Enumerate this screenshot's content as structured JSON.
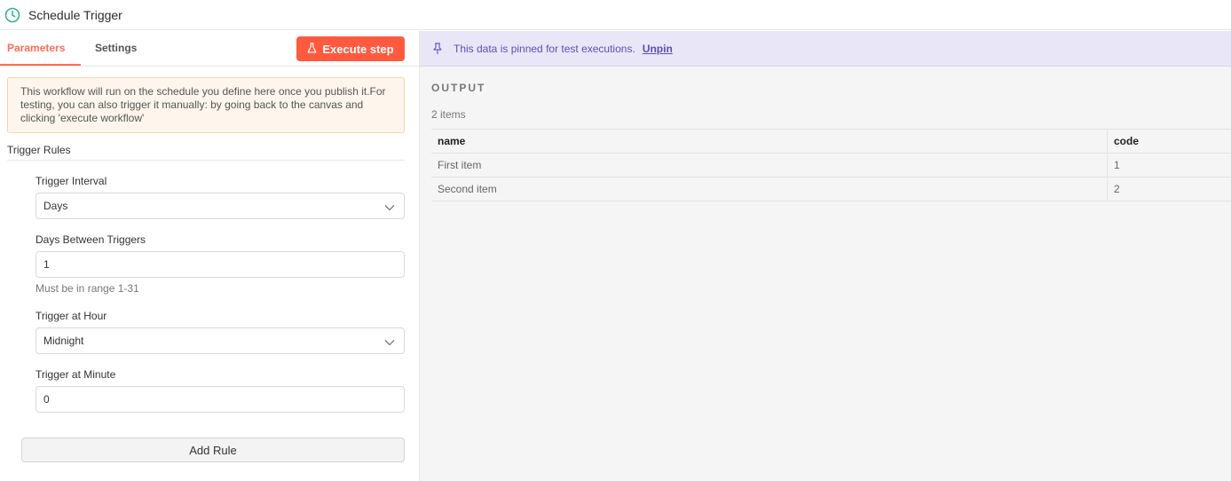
{
  "header": {
    "title": "Schedule Trigger",
    "icon": "clock-icon"
  },
  "tabs": [
    {
      "label": "Parameters",
      "active": true
    },
    {
      "label": "Settings",
      "active": false
    }
  ],
  "execute_button": {
    "label": "Execute step",
    "icon": "flask-icon"
  },
  "notice": {
    "text": "This workflow will run on the schedule you define here once you publish it.For testing, you can also trigger it manually: by going back to the canvas and clicking 'execute workflow'"
  },
  "trigger_rules": {
    "title": "Trigger Rules",
    "fields": {
      "interval": {
        "label": "Trigger Interval",
        "value": "Days"
      },
      "days_between": {
        "label": "Days Between Triggers",
        "value": "1",
        "hint": "Must be in range 1-31"
      },
      "hour": {
        "label": "Trigger at Hour",
        "value": "Midnight"
      },
      "minute": {
        "label": "Trigger at Minute",
        "value": "0"
      }
    },
    "add_rule_label": "Add Rule"
  },
  "pin_banner": {
    "message": "This data is pinned for test executions.",
    "unpin_label": "Unpin",
    "icon": "pin-icon"
  },
  "output": {
    "title": "OUTPUT",
    "count": "2 items",
    "columns": [
      "name",
      "code"
    ],
    "rows": [
      [
        "First item",
        "1"
      ],
      [
        "Second item",
        "2"
      ]
    ]
  },
  "colors": {
    "accent": "#ff6d5a",
    "button": "#ff5a3f",
    "pin_bg": "#e9e6f7",
    "pin_text": "#5b4fb5",
    "clock": "#2fb592"
  }
}
